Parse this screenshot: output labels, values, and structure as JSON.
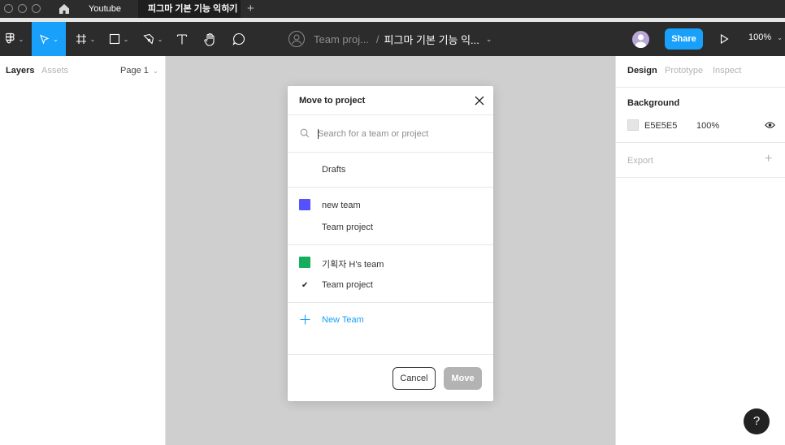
{
  "tabs": [
    {
      "label": "Youtube",
      "active": false
    },
    {
      "label": "피그마 기본 기능 익히기",
      "active": true
    }
  ],
  "tab_close_glyph": "×",
  "tab_add_glyph": "+",
  "toolbar": {
    "file_title": "Team proj...",
    "file_sep": "/",
    "file_name": "피그마 기본 기능 익...",
    "share_label": "Share",
    "zoom": "100%"
  },
  "left_panel": {
    "layers_tab": "Layers",
    "assets_tab": "Assets",
    "page_label": "Page 1"
  },
  "right_panel": {
    "design_tab": "Design",
    "prototype_tab": "Prototype",
    "inspect_tab": "Inspect",
    "background_heading": "Background",
    "background_hex": "E5E5E5",
    "background_opacity": "100%",
    "export_heading": "Export",
    "export_add_glyph": "+"
  },
  "modal": {
    "title": "Move to project",
    "search_placeholder": "Search for a team or project",
    "drafts": "Drafts",
    "teams": [
      {
        "name": "new team",
        "color": "#5551ff",
        "project": "Team project",
        "checked": false
      },
      {
        "name": "기획자 H's team",
        "color": "#14ae5c",
        "project": "Team project",
        "checked": true
      }
    ],
    "check_glyph": "✔",
    "new_team": "New Team",
    "cancel_label": "Cancel",
    "move_label": "Move"
  },
  "help_glyph": "?",
  "colors": {
    "accent": "#18a0fb",
    "topbar": "#2c2c2c",
    "canvas_bg": "#e5e5e5"
  },
  "icons": [
    "home-icon",
    "figma-menu-icon",
    "move-tool-icon",
    "frame-tool-icon",
    "shape-tool-icon",
    "pen-tool-icon",
    "text-tool-icon",
    "hand-tool-icon",
    "comment-tool-icon",
    "team-icon",
    "play-icon",
    "search-icon",
    "close-icon",
    "plus-icon",
    "eye-icon",
    "help-icon"
  ]
}
